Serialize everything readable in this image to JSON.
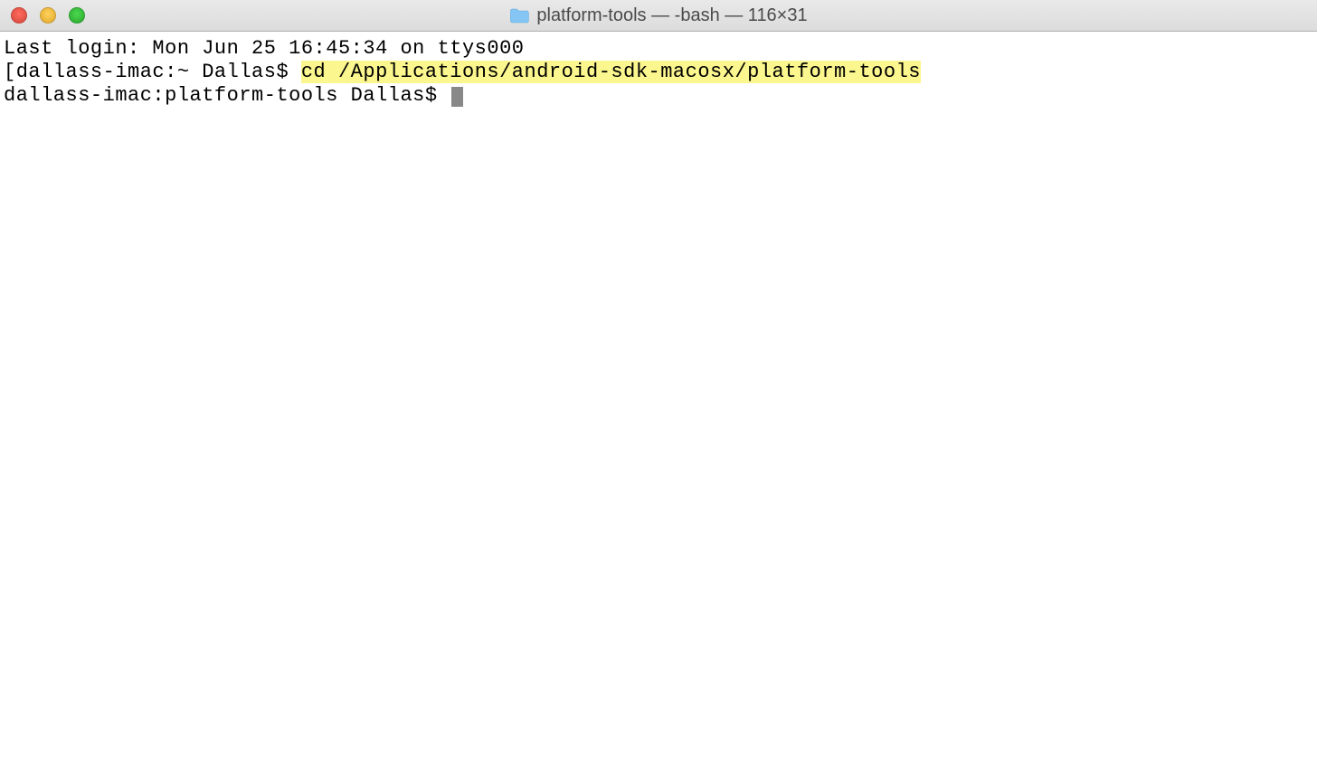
{
  "window": {
    "title": "platform-tools — -bash — 116×31"
  },
  "terminal": {
    "last_login": "Last login: Mon Jun 25 16:45:34 on ttys000",
    "line1_prompt": "[dallass-imac:~ Dallas$ ",
    "line1_command": "cd /Applications/android-sdk-macosx/platform-tools",
    "line2_prompt": "dallass-imac:platform-tools Dallas$ "
  }
}
